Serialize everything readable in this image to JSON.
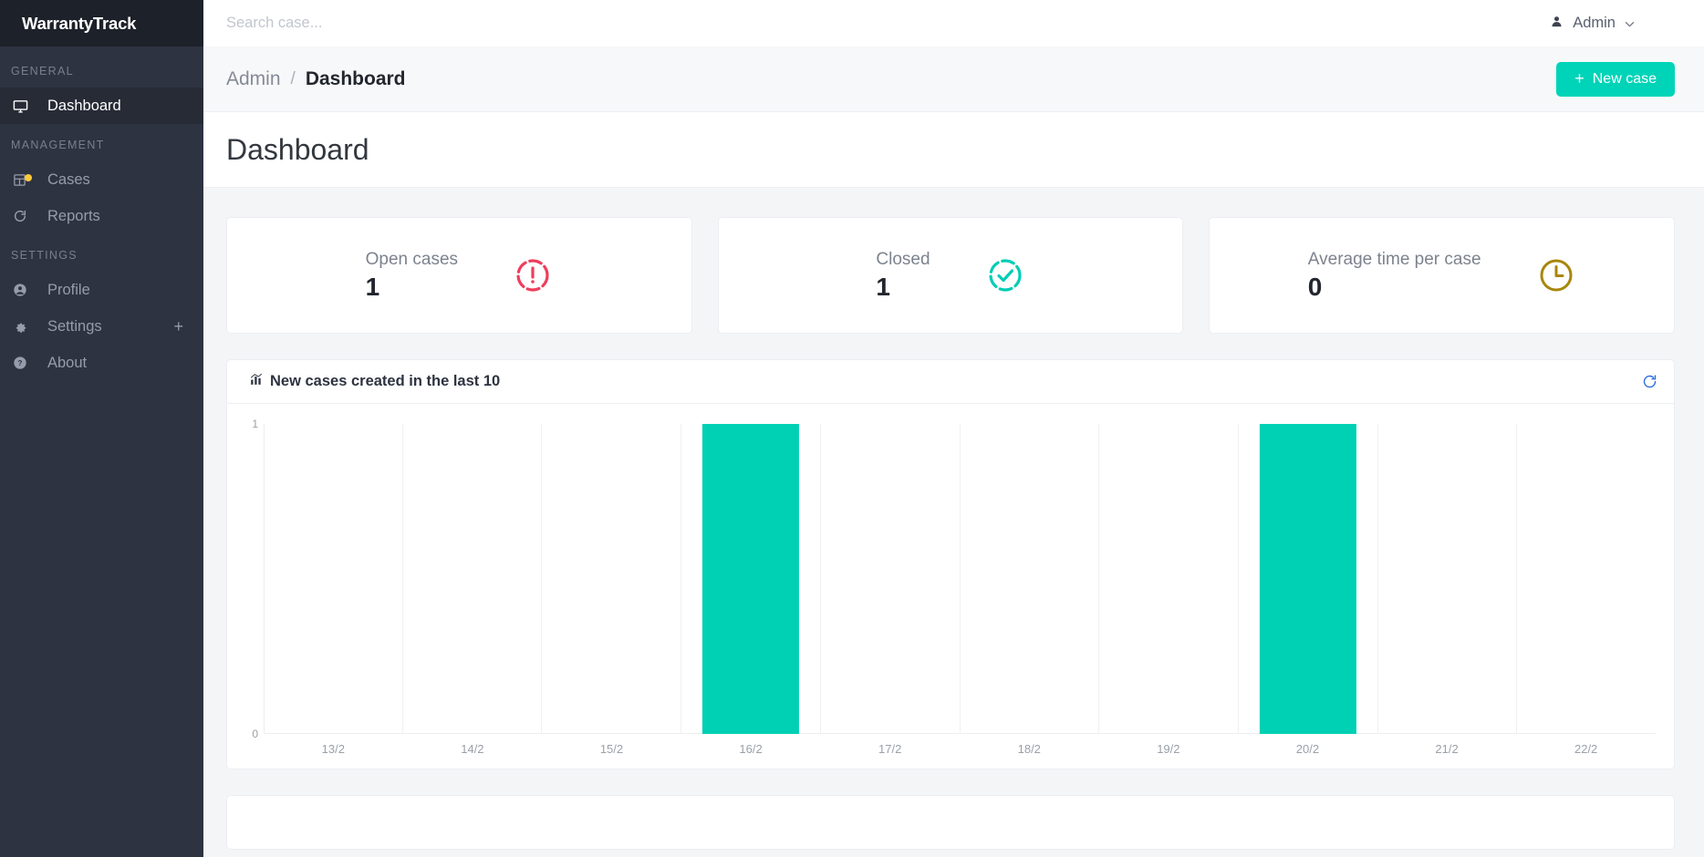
{
  "brand": {
    "name": "WarrantyTrack"
  },
  "sidebar": {
    "sections": [
      {
        "title": "GENERAL",
        "items": [
          {
            "label": "Dashboard",
            "icon": "monitor-icon",
            "active": true
          }
        ]
      },
      {
        "title": "MANAGEMENT",
        "items": [
          {
            "label": "Cases",
            "icon": "grid-icon",
            "active": false,
            "badge": true
          },
          {
            "label": "Reports",
            "icon": "refresh-circle-icon",
            "active": false
          }
        ]
      },
      {
        "title": "SETTINGS",
        "items": [
          {
            "label": "Profile",
            "icon": "user-circle-icon",
            "active": false
          },
          {
            "label": "Settings",
            "icon": "gear-icon",
            "active": false,
            "expand": "+"
          },
          {
            "label": "About",
            "icon": "question-circle-icon",
            "active": false
          }
        ]
      }
    ]
  },
  "topbar": {
    "search_placeholder": "Search case...",
    "search_value": "",
    "user_name": "Admin",
    "caret": "⌄"
  },
  "breadcrumb": {
    "parent": "Admin",
    "separator": "/",
    "current": "Dashboard"
  },
  "actions": {
    "new_case_label": "New case",
    "new_case_plus": "+"
  },
  "page": {
    "title": "Dashboard"
  },
  "stats": [
    {
      "label": "Open cases",
      "value": "1",
      "icon": "alert-circle-dashed-icon",
      "color": "#ef3e5c"
    },
    {
      "label": "Closed",
      "value": "1",
      "icon": "check-circle-dashed-icon",
      "color": "#00cdb4"
    },
    {
      "label": "Average time per case",
      "value": "0",
      "icon": "clock-icon",
      "color": "#a8860b"
    }
  ],
  "chart_card": {
    "title": "New cases created in the last 10",
    "title_icon": "bar-chart-icon",
    "refresh_icon": "refresh-icon",
    "refresh_color": "#2f6fe0"
  },
  "chart_data": {
    "type": "bar",
    "title": "New cases created in the last 10",
    "categories": [
      "13/2",
      "14/2",
      "15/2",
      "16/2",
      "17/2",
      "18/2",
      "19/2",
      "20/2",
      "21/2",
      "22/2"
    ],
    "values": [
      0,
      0,
      0,
      1,
      0,
      0,
      0,
      1,
      0,
      0
    ],
    "xlabel": "",
    "ylabel": "",
    "ylim": [
      0,
      1
    ],
    "yticks": [
      "0",
      "1"
    ],
    "grid": true,
    "legend": false,
    "bar_color": "#00d0b4"
  },
  "colors": {
    "accent": "#00d4b8",
    "sidebar_bg": "#2d3340",
    "brand_bg": "#1d2129",
    "page_bg": "#f4f5f7"
  }
}
